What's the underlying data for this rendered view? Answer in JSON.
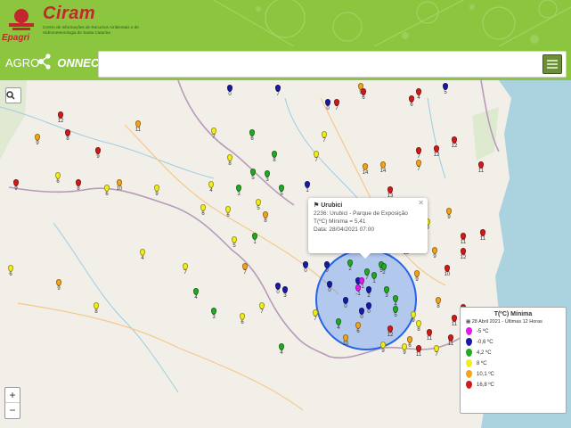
{
  "header": {
    "brand": "Ciram",
    "brand_sub": "Centro de Informações de Recursos Ambientais e de Hidrometeorologia de Santa Catarina",
    "logo_text": "Epagri"
  },
  "agro": {
    "label_prefix": "AGRO",
    "label_suffix": "ONNECT",
    "search_placeholder": ""
  },
  "popup": {
    "title": "Urubici",
    "station": "2236: Urubici - Parque de Exposição",
    "measure": "T(ºC) Mínima = 5,41",
    "date": "Data: 28/04/2021 07:00"
  },
  "legend": {
    "title": "T(ºC) Mínima",
    "date": "28 Abril 2021 - Últimas 12 Horas",
    "items": [
      {
        "label": "-5 ºC",
        "color": "#e31aee"
      },
      {
        "label": "-0,6 ºC",
        "color": "#1a1aa8"
      },
      {
        "label": "4,2 ºC",
        "color": "#22aa22"
      },
      {
        "label": "8 ºC",
        "color": "#f1ee1a"
      },
      {
        "label": "10,1 ºC",
        "color": "#f2a51a"
      },
      {
        "label": "16,8 ºC",
        "color": "#d21a1a"
      }
    ]
  },
  "zoom": {
    "in": "+",
    "out": "−",
    "search_icon": "search-icon"
  },
  "pins": [
    {
      "v": "0",
      "c": "#1a1aa8"
    },
    {
      "v": "0",
      "c": "#1a1aa8"
    },
    {
      "v": "7",
      "c": "#1a1aa8"
    },
    {
      "v": "9",
      "c": "#f2a51a"
    },
    {
      "v": "4",
      "c": "#d21a1a"
    },
    {
      "v": "7",
      "c": "#d21a1a"
    },
    {
      "v": "6",
      "c": "#d21a1a"
    },
    {
      "v": "5",
      "c": "#1a1aa8"
    },
    {
      "v": "6",
      "c": "#d21a1a"
    },
    {
      "v": "12",
      "c": "#d21a1a"
    },
    {
      "v": "11",
      "c": "#f2a51a"
    },
    {
      "v": "9",
      "c": "#f2a51a"
    },
    {
      "v": "8",
      "c": "#d21a1a"
    },
    {
      "v": "7",
      "c": "#f1ee1a"
    },
    {
      "v": "7",
      "c": "#f1ee1a"
    },
    {
      "v": "12",
      "c": "#d21a1a"
    },
    {
      "v": "9",
      "c": "#d21a1a"
    },
    {
      "v": "6",
      "c": "#22aa22"
    },
    {
      "v": "8",
      "c": "#22aa22"
    },
    {
      "v": "8",
      "c": "#f1ee1a"
    },
    {
      "v": "7",
      "c": "#d21a1a"
    },
    {
      "v": "14",
      "c": "#f2a51a"
    },
    {
      "v": "9",
      "c": "#d21a1a"
    },
    {
      "v": "8",
      "c": "#d21a1a"
    },
    {
      "v": "6",
      "c": "#f1ee1a"
    },
    {
      "v": "6",
      "c": "#f1ee1a"
    },
    {
      "v": "5",
      "c": "#22aa22"
    },
    {
      "v": "3",
      "c": "#22aa22"
    },
    {
      "v": "5",
      "c": "#22aa22"
    },
    {
      "v": "5",
      "c": "#f1ee1a"
    },
    {
      "v": "1",
      "c": "#1a1aa8"
    },
    {
      "v": "4",
      "c": "#f1ee1a"
    },
    {
      "v": "3",
      "c": "#22aa22"
    },
    {
      "v": "7",
      "c": "#f1ee1a"
    },
    {
      "v": "12",
      "c": "#d21a1a"
    },
    {
      "v": "13",
      "c": "#d21a1a"
    },
    {
      "v": "11",
      "c": "#d21a1a"
    },
    {
      "v": "7",
      "c": "#f2a51a"
    },
    {
      "v": "10",
      "c": "#f2a51a"
    },
    {
      "v": "9",
      "c": "#f1ee1a"
    },
    {
      "v": "6",
      "c": "#f1ee1a"
    },
    {
      "v": "6",
      "c": "#f1ee1a"
    },
    {
      "v": "5",
      "c": "#f1ee1a"
    },
    {
      "v": "1",
      "c": "#22aa22"
    },
    {
      "v": "8",
      "c": "#f2a51a"
    },
    {
      "v": "7",
      "c": "#f2a51a"
    },
    {
      "v": "0",
      "c": "#1a1aa8"
    },
    {
      "v": "3",
      "c": "#1a1aa8"
    },
    {
      "v": "4",
      "c": "#22aa22"
    },
    {
      "v": "0",
      "c": "#1a1aa8"
    },
    {
      "v": "5",
      "c": "#22aa22"
    },
    {
      "v": "7",
      "c": "#22aa22"
    },
    {
      "v": "4",
      "c": "#22aa22"
    },
    {
      "v": "9",
      "c": "#f1ee1a"
    },
    {
      "v": "8",
      "c": "#f1ee1a"
    },
    {
      "v": "9",
      "c": "#f1ee1a"
    },
    {
      "v": "14",
      "c": "#f2a51a"
    },
    {
      "v": "9",
      "c": "#f1ee1a"
    },
    {
      "v": "12",
      "c": "#d21a1a"
    },
    {
      "v": "9",
      "c": "#f2a51a"
    },
    {
      "v": "9",
      "c": "#f1ee1a"
    },
    {
      "v": "6",
      "c": "#f1ee1a"
    },
    {
      "v": "11",
      "c": "#d21a1a"
    },
    {
      "v": "11",
      "c": "#d21a1a"
    },
    {
      "v": "12",
      "c": "#d21a1a"
    },
    {
      "v": "14",
      "c": "#d21a1a"
    },
    {
      "v": "9",
      "c": "#f2a51a"
    },
    {
      "v": "10",
      "c": "#d21a1a"
    },
    {
      "v": "4",
      "c": "#f1ee1a"
    },
    {
      "v": "7",
      "c": "#f1ee1a"
    },
    {
      "v": "11",
      "c": "#d21a1a"
    },
    {
      "v": "9",
      "c": "#f2a51a"
    },
    {
      "v": "7",
      "c": "#f1ee1a"
    },
    {
      "v": "0",
      "c": "#1a1aa8"
    },
    {
      "v": "4",
      "c": "#22aa22"
    },
    {
      "v": "4",
      "c": "#22aa22"
    },
    {
      "v": "2",
      "c": "#22aa22"
    },
    {
      "v": "5",
      "c": "#f1ee1a"
    },
    {
      "v": "2",
      "c": "#22aa22"
    },
    {
      "v": "0",
      "c": "#1a1aa8"
    },
    {
      "v": "2",
      "c": "#1a1aa8"
    },
    {
      "v": "-1",
      "c": "#e31aee"
    },
    {
      "v": "-1",
      "c": "#e31aee"
    },
    {
      "v": "0",
      "c": "#1a1aa8"
    },
    {
      "v": "1",
      "c": "#22aa22"
    },
    {
      "v": "0",
      "c": "#1a1aa8"
    },
    {
      "v": "0",
      "c": "#1a1aa8"
    },
    {
      "v": "3",
      "c": "#22aa22"
    },
    {
      "v": "5",
      "c": "#22aa22"
    },
    {
      "v": "9",
      "c": "#f2a51a"
    },
    {
      "v": "6",
      "c": "#f1ee1a"
    },
    {
      "v": "8",
      "c": "#f1ee1a"
    },
    {
      "v": "4",
      "c": "#22aa22"
    },
    {
      "v": "3",
      "c": "#22aa22"
    },
    {
      "v": "6",
      "c": "#f1ee1a"
    },
    {
      "v": "7",
      "c": "#f1ee1a"
    },
    {
      "v": "12",
      "c": "#d21a1a"
    },
    {
      "v": "8",
      "c": "#f2a51a"
    },
    {
      "v": "9",
      "c": "#f1ee1a"
    },
    {
      "v": "11",
      "c": "#d21a1a"
    },
    {
      "v": "12",
      "c": "#d21a1a"
    },
    {
      "v": "11",
      "c": "#d21a1a"
    },
    {
      "v": "11",
      "c": "#d21a1a"
    },
    {
      "v": "8",
      "c": "#f1ee1a"
    },
    {
      "v": "10",
      "c": "#f2a51a"
    },
    {
      "v": "9",
      "c": "#f1ee1a"
    },
    {
      "v": "9",
      "c": "#f1ee1a"
    },
    {
      "v": "11",
      "c": "#d21a1a"
    },
    {
      "v": "7",
      "c": "#f1ee1a"
    },
    {
      "v": "0",
      "c": "#1a1aa8"
    },
    {
      "v": "4",
      "c": "#22aa22"
    },
    {
      "v": "4",
      "c": "#22aa22"
    },
    {
      "v": "7",
      "c": "#f1ee1a"
    },
    {
      "v": "6",
      "c": "#f2a51a"
    },
    {
      "v": "6",
      "c": "#f2a51a"
    }
  ]
}
